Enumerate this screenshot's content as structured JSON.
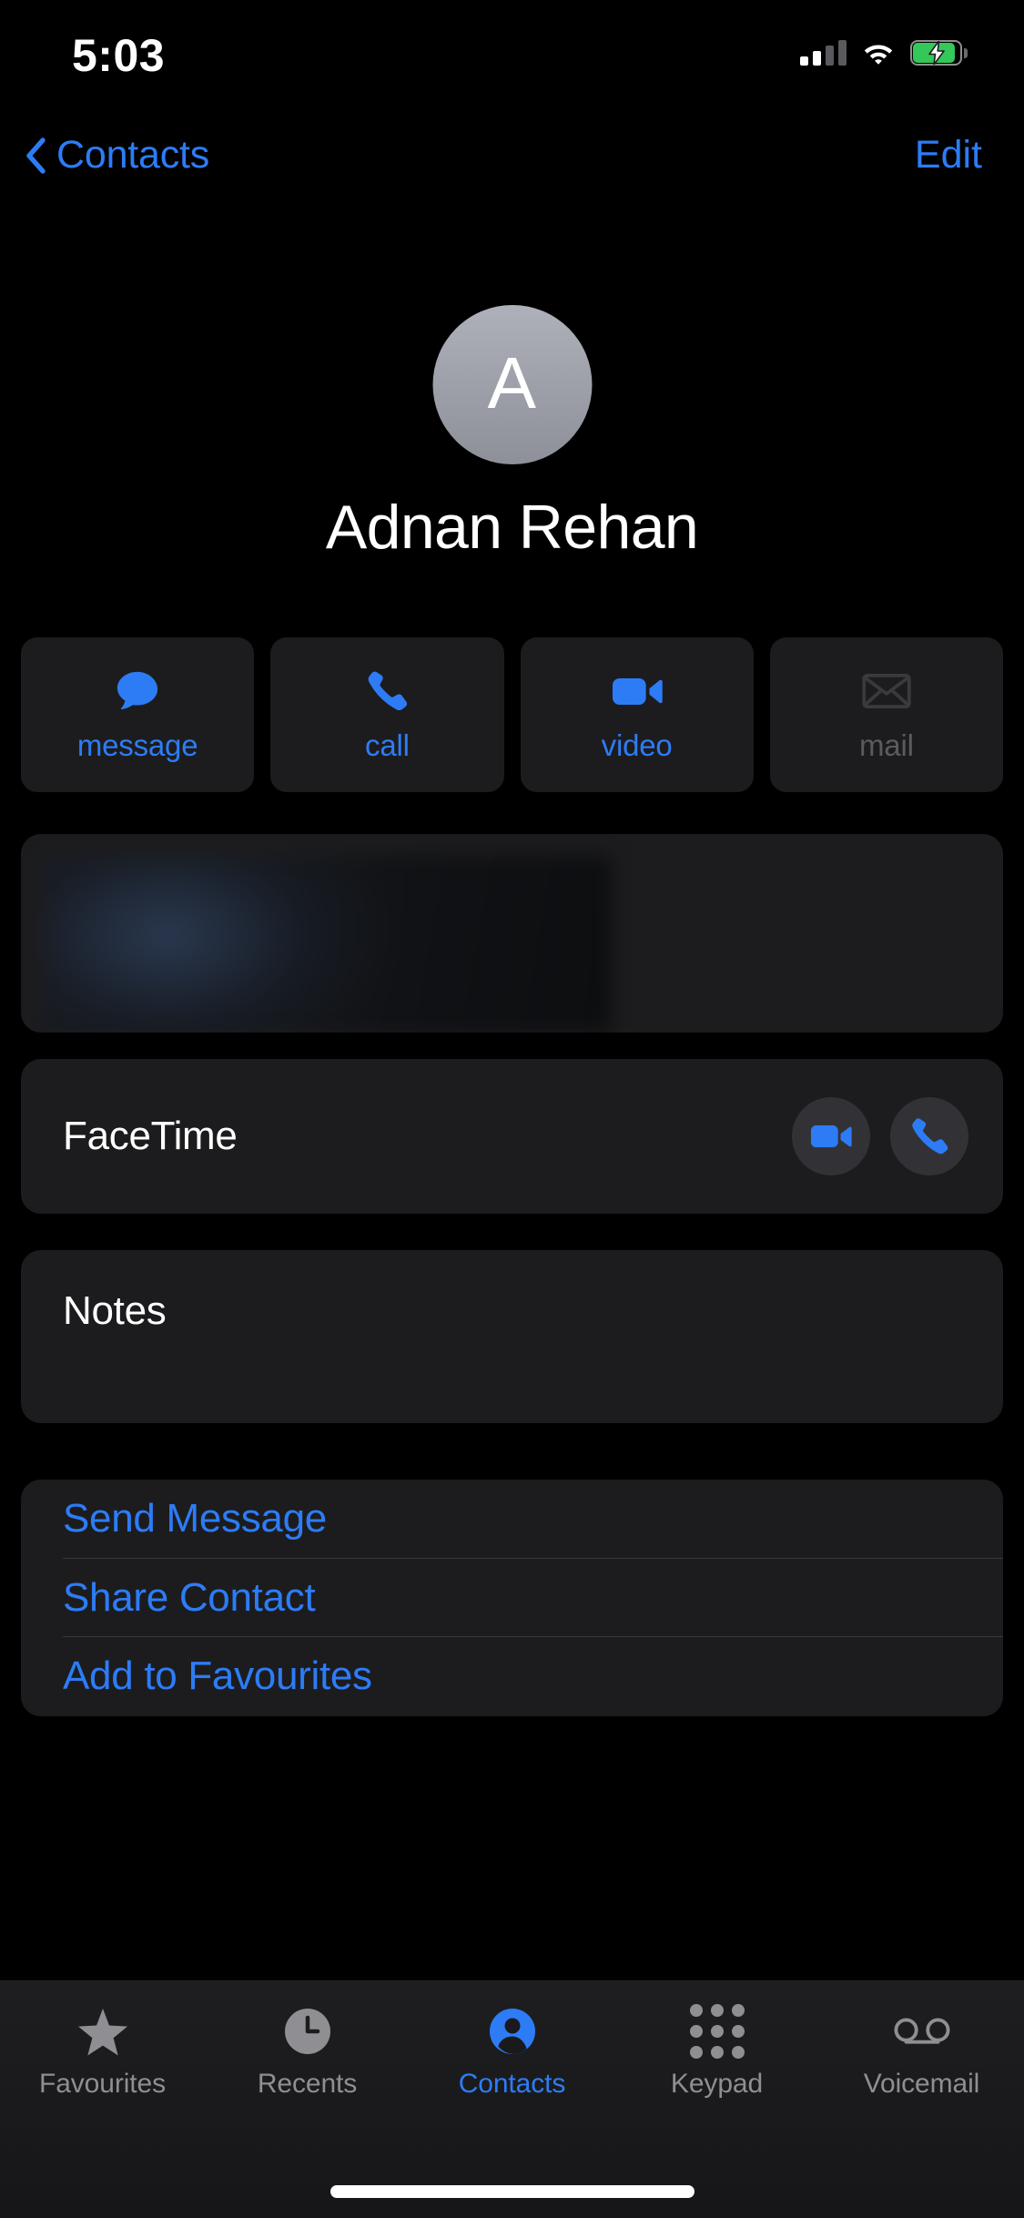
{
  "status_bar": {
    "time": "5:03",
    "signal_icon": "cellular-signal-icon",
    "signal_bars_filled": 2,
    "signal_bars_total": 4,
    "wifi_icon": "wifi-icon",
    "battery_icon": "battery-charging-icon",
    "battery_color": "#34c759"
  },
  "nav_bar": {
    "back_icon": "chevron-left-icon",
    "back_label": "Contacts",
    "edit_label": "Edit",
    "accent_color": "#2d7cf6"
  },
  "header": {
    "avatar_initial": "A",
    "avatar_icon": "avatar-monogram",
    "contact_name": "Adnan Rehan"
  },
  "quick_actions": [
    {
      "label": "message",
      "icon": "message-bubble-icon",
      "enabled": true
    },
    {
      "label": "call",
      "icon": "phone-handset-icon",
      "enabled": true
    },
    {
      "label": "video",
      "icon": "video-camera-icon",
      "enabled": true
    },
    {
      "label": "mail",
      "icon": "envelope-icon",
      "enabled": false
    }
  ],
  "phone_card": {
    "redacted": true,
    "icon": "blurred-redaction"
  },
  "facetime_card": {
    "label": "FaceTime",
    "video_icon": "video-camera-icon",
    "audio_icon": "phone-handset-icon"
  },
  "notes_card": {
    "label": "Notes",
    "value": ""
  },
  "action_list": [
    {
      "label": "Send Message"
    },
    {
      "label": "Share Contact"
    },
    {
      "label": "Add to Favourites"
    }
  ],
  "tab_bar": {
    "active_index": 2,
    "tabs": [
      {
        "label": "Favourites",
        "icon": "star-icon"
      },
      {
        "label": "Recents",
        "icon": "clock-icon"
      },
      {
        "label": "Contacts",
        "icon": "person-circle-icon"
      },
      {
        "label": "Keypad",
        "icon": "keypad-grid-icon"
      },
      {
        "label": "Voicemail",
        "icon": "voicemail-icon"
      }
    ]
  },
  "home_indicator": {
    "icon": "home-indicator-bar"
  }
}
